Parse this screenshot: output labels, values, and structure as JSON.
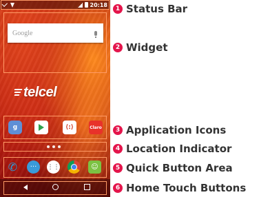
{
  "status_bar": {
    "clock": "20:18"
  },
  "search_widget": {
    "placeholder": "Google"
  },
  "carrier_logo": {
    "text": "telcel"
  },
  "apps": [
    {
      "name": "google-plus",
      "glyph": "g"
    },
    {
      "name": "play-store",
      "glyph": ""
    },
    {
      "name": "media",
      "glyph": "⟨:⟩"
    },
    {
      "name": "claro",
      "glyph": "Claro"
    }
  ],
  "quick_buttons": {
    "phone_glyph": "✆",
    "messages_glyph": "···",
    "apps_glyph": "⋮⋮",
    "chat_glyph": "☺"
  },
  "callouts": [
    {
      "number": "1",
      "label": "Status Bar"
    },
    {
      "number": "2",
      "label": "Widget"
    },
    {
      "number": "3",
      "label": "Application Icons"
    },
    {
      "number": "4",
      "label": "Location Indicator"
    },
    {
      "number": "5",
      "label": "Quick Button Area"
    },
    {
      "number": "6",
      "label": "Home Touch Buttons"
    }
  ],
  "colors": {
    "badge": "#e4154b",
    "label_text": "#333333",
    "highlight": "#ff9b66"
  }
}
